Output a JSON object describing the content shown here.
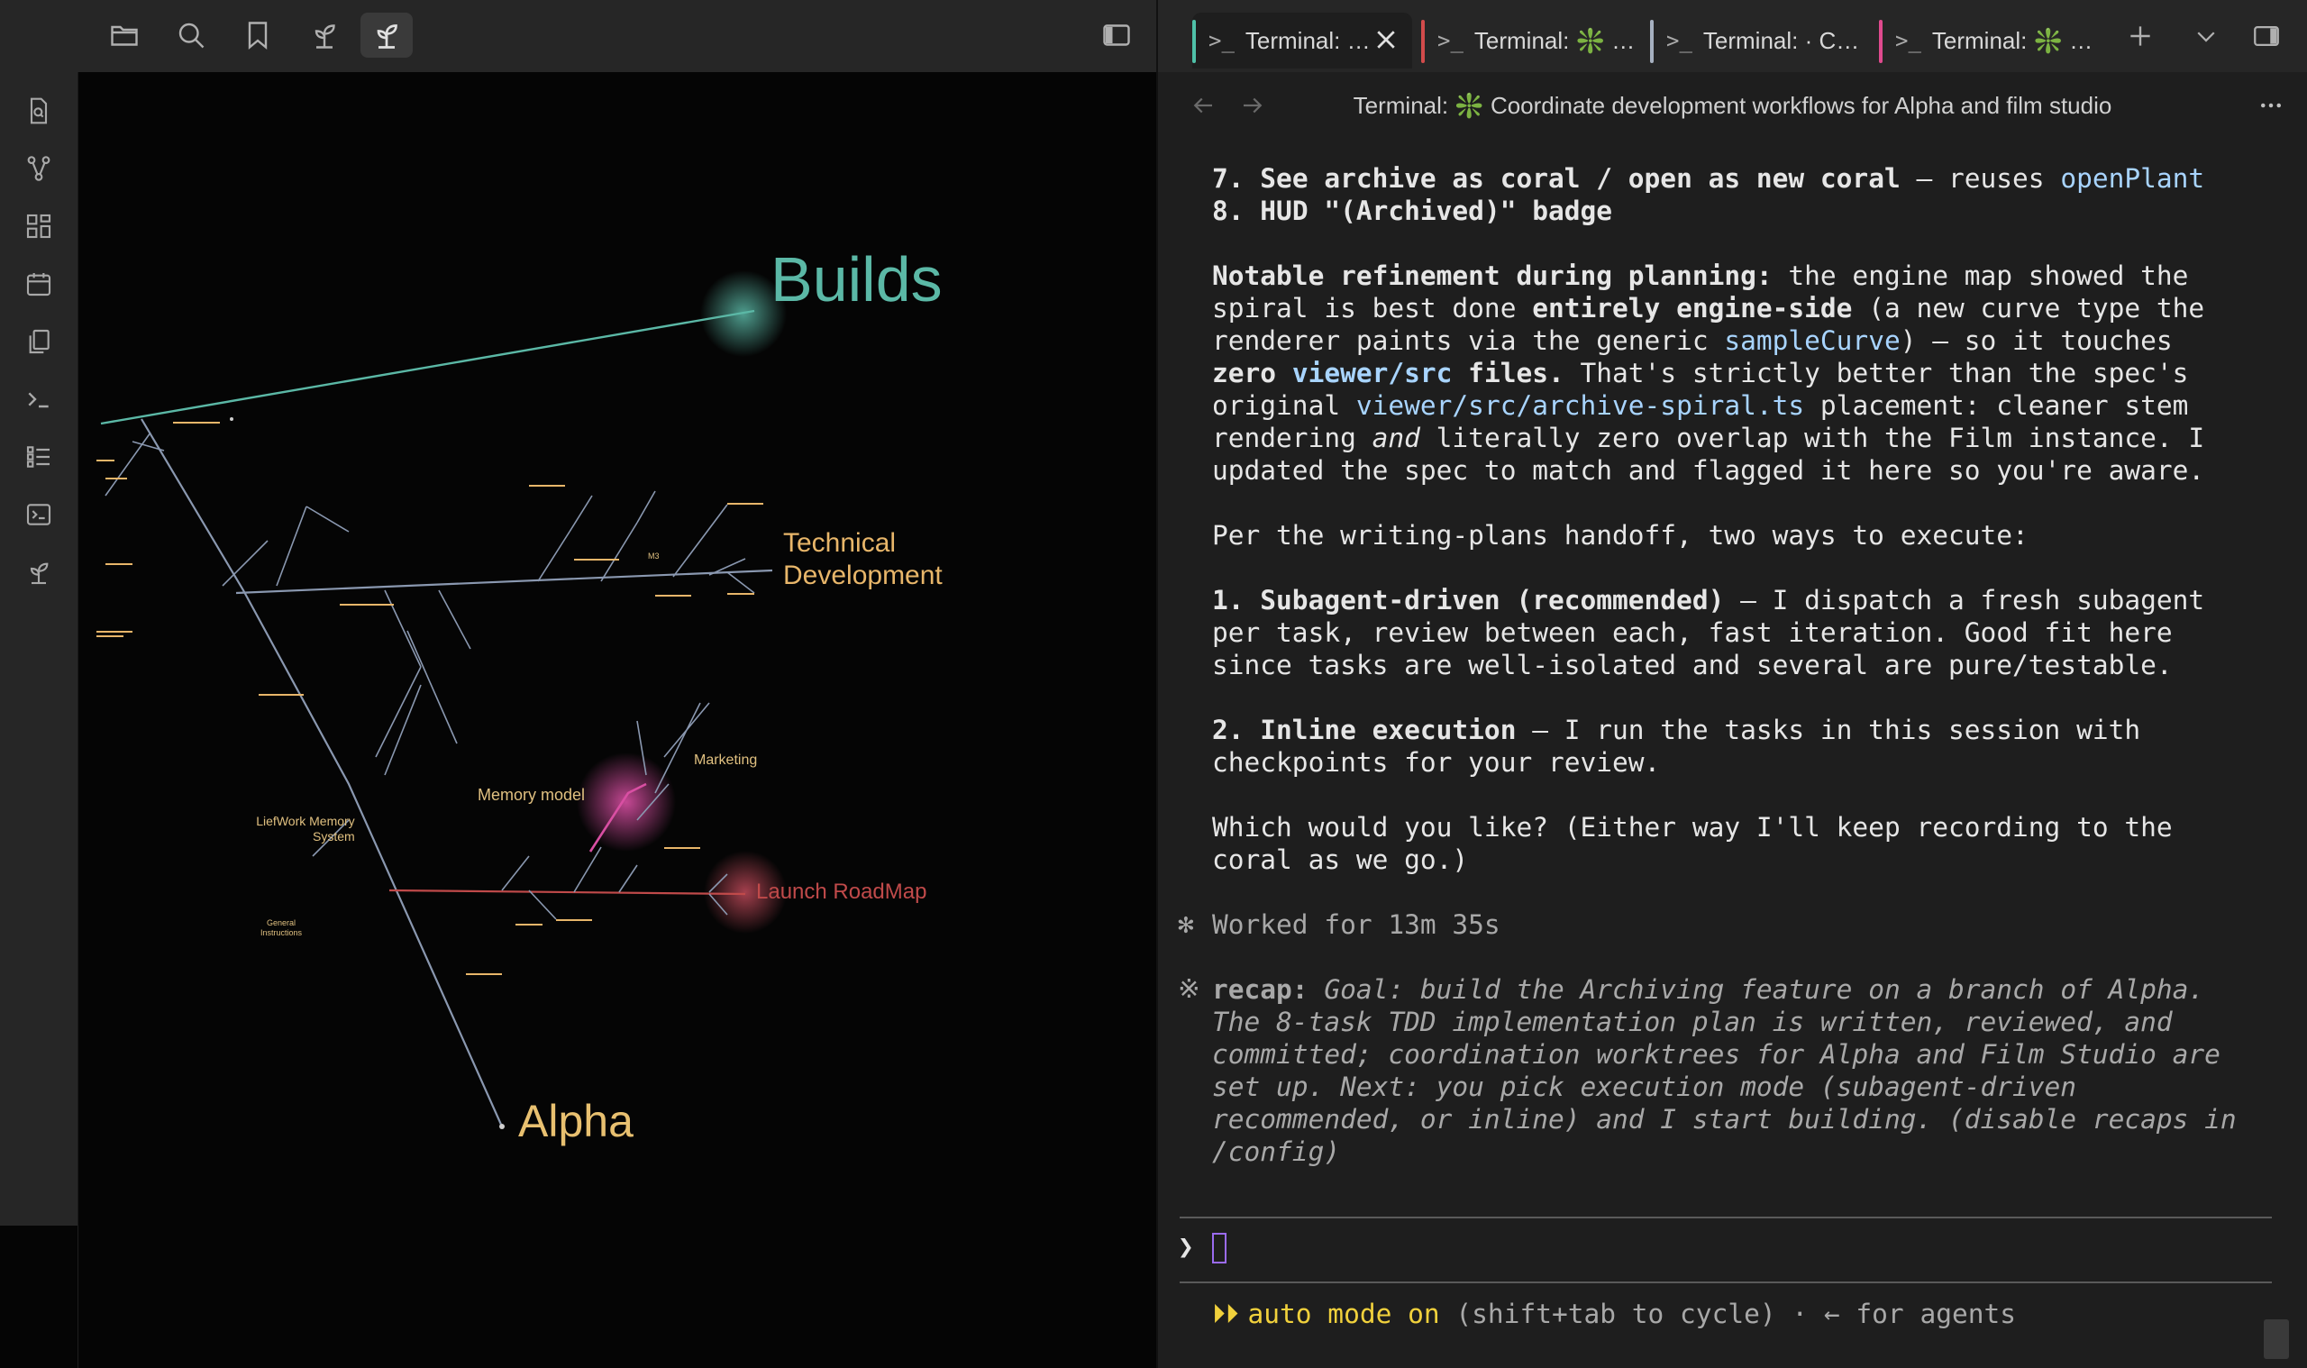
{
  "graph": {
    "labels": {
      "builds": "Builds",
      "technical": "Technical",
      "development": "Development",
      "memory_model": "Memory model",
      "marketing": "Marketing",
      "liefwork_1": "LiefWork Memory",
      "liefwork_2": "System",
      "general_1": "General",
      "general_2": "Instructions",
      "launch": "Launch RoadMap",
      "alpha": "Alpha",
      "m3": "M3"
    },
    "colors": {
      "builds": "#5bb8a6",
      "technical": "#e8b66a",
      "launch": "#c04a4a",
      "alpha": "#e8c070",
      "stem": "#8a98b0",
      "magenta": "#d94fa3"
    }
  },
  "tabs": [
    {
      "label": "Terminal: …",
      "color": "#4fc1a8"
    },
    {
      "label": "Terminal: ❇️ …",
      "color": "#d24b4b"
    },
    {
      "label": "Terminal: · C…",
      "color": "#a6b0c0"
    },
    {
      "label": "Terminal: ❇️ …",
      "color": "#e04a8e"
    }
  ],
  "header": {
    "title": "Terminal: ❇️ Coordinate development workflows for Alpha and film studio"
  },
  "terminal": {
    "l7": {
      "n": "7. ",
      "b": "See archive as coral / open as new coral",
      "t": " — reuses ",
      "k": "openPlant"
    },
    "l8": {
      "n": "8. ",
      "b": "HUD \"(Archived)\" badge"
    },
    "p1a": {
      "b": "Notable refinement during planning:",
      "t": " the engine map showed the"
    },
    "p1b": {
      "a": "spiral is best done ",
      "b": "entirely engine-side",
      "c": " (a new curve type the"
    },
    "p1c": {
      "a": "renderer paints via the generic ",
      "k": "sampleCurve",
      "c": ") — so it touches"
    },
    "p1d": {
      "b1": "zero ",
      "k": "viewer/src",
      "b2": " files.",
      "c": " That's strictly better than the spec's"
    },
    "p1e": {
      "a": "original ",
      "k": "viewer/src/archive-spiral.ts",
      "c": " placement: cleaner stem"
    },
    "p1f": {
      "a": "rendering ",
      "i": "and",
      "c": " literally zero overlap with the Film instance. I"
    },
    "p1g": "updated the spec to match and flagged it here so you're aware.",
    "p2": "Per the writing-plans handoff, two ways to execute:",
    "o1a": {
      "b": "1. Subagent-driven (recommended)",
      "t": " — I dispatch a fresh subagent"
    },
    "o1b": "per task, review between each, fast iteration. Good fit here",
    "o1c": "since tasks are well-isolated and several are pure/testable.",
    "o2a": {
      "b": "2. Inline execution",
      "t": " — I run the tasks in this session with"
    },
    "o2b": "checkpoints for your review.",
    "q1": "Which would you like? (Either way I'll keep recording to the",
    "q2": "coral as we go.)",
    "worked_star": "✻",
    "worked": "Worked for 13m 35s",
    "recap_star": "※",
    "recap_label": "recap:",
    "recap1": " Goal: build the Archiving feature on a branch of Alpha.",
    "recap2": "The 8-task TDD implementation plan is written, reviewed, and",
    "recap3": "committed; coordination worktrees for Alpha and Film Studio are",
    "recap4": "set up. Next: you pick execution mode (subagent-driven",
    "recap5": "recommended, or inline) and I start building. (disable recaps in",
    "recap6": "/config)",
    "prompt": "❯",
    "mode_glyph": "⏵⏵",
    "mode": "auto mode on",
    "mode_hint": " (shift+tab to cycle) · ← for agents"
  }
}
